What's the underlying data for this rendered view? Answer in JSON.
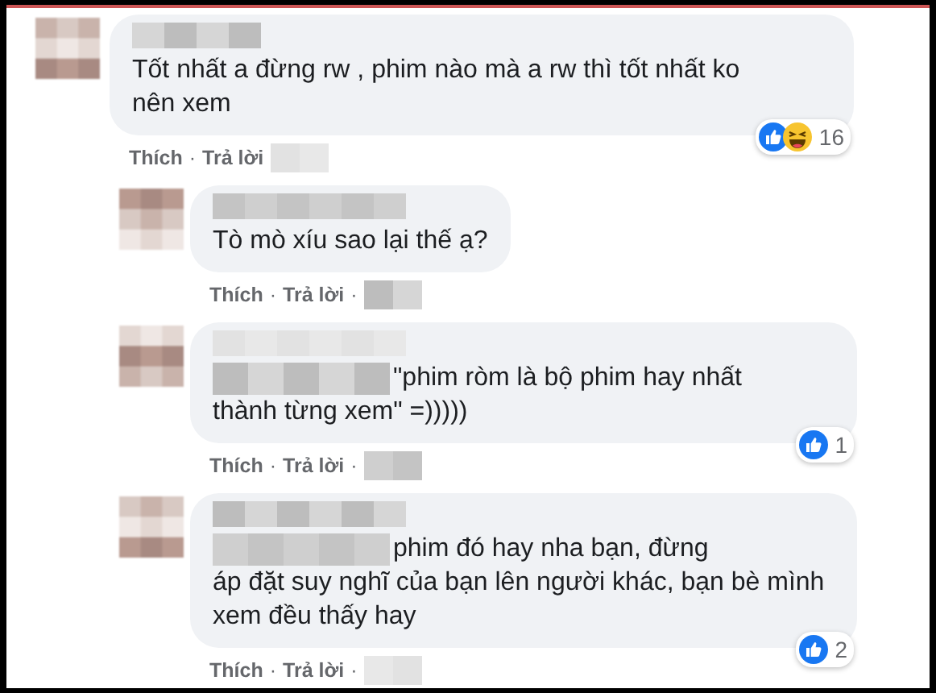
{
  "separator": "·",
  "comments": [
    {
      "text": "Tốt nhất a đừng rw , phim nào mà a rw thì tốt nhất ko nên xem",
      "reactions": {
        "icons": [
          {
            "kind": "like"
          },
          {
            "kind": "haha"
          }
        ],
        "count": "16"
      },
      "actions": [
        {
          "label": "Thích"
        },
        {
          "label": "Trả lời"
        }
      ],
      "trailing_separator": false,
      "replies": [
        {
          "text": "Tò mò xíu sao lại thế ạ?",
          "actions": [
            {
              "label": "Thích"
            },
            {
              "label": "Trả lời"
            }
          ],
          "trailing_separator": true
        },
        {
          "text_head": "\"phim ròm là bộ phim hay nhất",
          "text": "thành từng xem\" =)))))",
          "reactions": {
            "icons": [
              {
                "kind": "like"
              }
            ],
            "count": "1"
          },
          "actions": [
            {
              "label": "Thích"
            },
            {
              "label": "Trả lời"
            }
          ],
          "trailing_separator": true
        },
        {
          "text_head": "phim đó hay nha bạn, đừng",
          "text": "áp đặt suy nghĩ của bạn lên người khác, bạn bè mình xem đều thấy hay",
          "reactions": {
            "icons": [
              {
                "kind": "like"
              }
            ],
            "count": "2"
          },
          "actions": [
            {
              "label": "Thích"
            },
            {
              "label": "Trả lời"
            }
          ],
          "trailing_separator": true
        }
      ]
    }
  ]
}
